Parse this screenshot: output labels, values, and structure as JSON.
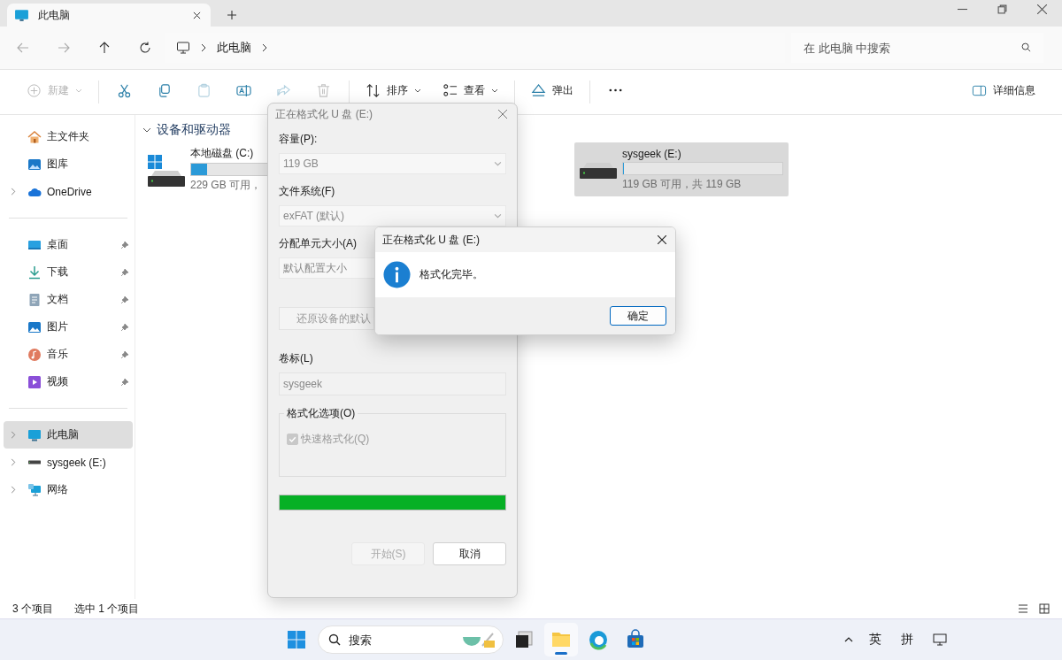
{
  "window": {
    "tab": "此电脑"
  },
  "nav": {
    "breadcrumb": [
      "此电脑"
    ],
    "search": {
      "placeholder": "在 此电脑 中搜索"
    }
  },
  "toolbar": {
    "items": [
      {
        "kind": "new",
        "label": "新建",
        "disabled": true
      },
      {
        "kind": "cut",
        "disabled": false
      },
      {
        "kind": "copy",
        "disabled": false
      },
      {
        "kind": "paste",
        "disabled": true
      },
      {
        "kind": "rename",
        "disabled": false
      },
      {
        "kind": "share",
        "disabled": true
      },
      {
        "kind": "delete",
        "disabled": true
      },
      {
        "kind": "sort",
        "label": "排序",
        "disabled": false
      },
      {
        "kind": "view",
        "label": "查看",
        "disabled": false
      },
      {
        "kind": "eject",
        "label": "弹出",
        "disabled": false
      },
      {
        "kind": "more",
        "disabled": false
      }
    ],
    "details": "详细信息"
  },
  "sidebar": {
    "groups": [
      [
        {
          "label": "主文件夹",
          "kind": "home",
          "expandable": false,
          "pinned": false,
          "selected": false
        },
        {
          "label": "图库",
          "kind": "gallery",
          "expandable": false,
          "pinned": false,
          "selected": false
        },
        {
          "label": "OneDrive",
          "kind": "cloud",
          "expandable": true,
          "pinned": false,
          "selected": false
        }
      ],
      [
        {
          "label": "桌面",
          "kind": "desktop",
          "expandable": false,
          "pinned": true,
          "selected": false
        },
        {
          "label": "下载",
          "kind": "download",
          "expandable": false,
          "pinned": true,
          "selected": false
        },
        {
          "label": "文档",
          "kind": "document",
          "expandable": false,
          "pinned": true,
          "selected": false
        },
        {
          "label": "图片",
          "kind": "pictures",
          "expandable": false,
          "pinned": true,
          "selected": false
        },
        {
          "label": "音乐",
          "kind": "music",
          "expandable": false,
          "pinned": true,
          "selected": false
        },
        {
          "label": "视频",
          "kind": "video",
          "expandable": false,
          "pinned": true,
          "selected": false
        }
      ],
      [
        {
          "label": "此电脑",
          "kind": "pc",
          "expandable": true,
          "pinned": false,
          "selected": true
        },
        {
          "label": "sysgeek (E:)",
          "kind": "usb",
          "expandable": true,
          "pinned": false,
          "selected": false
        },
        {
          "label": "网络",
          "kind": "network",
          "expandable": true,
          "pinned": false,
          "selected": false
        }
      ]
    ]
  },
  "content": {
    "section": "设备和驱动器",
    "drives": [
      {
        "kind": "system",
        "name": "本地磁盘 (C:)",
        "level": 0.1,
        "free": "229 GB 可用，",
        "selected": false
      },
      {
        "kind": "usb",
        "name": "sysgeek (E:)",
        "level": 0,
        "free": "119 GB 可用，共 119 GB",
        "selected": true
      }
    ]
  },
  "status_bar": {
    "count": "3 个项目",
    "selection": "选中 1 个项目"
  },
  "format_dialog": {
    "title": "正在格式化 U 盘 (E:)",
    "capacity": {
      "label": "容量(P):",
      "value": "119 GB"
    },
    "file_system": {
      "label": "文件系统(F)",
      "value": "exFAT (默认)"
    },
    "allocation": {
      "label": "分配单元大小(A)",
      "value": "默认配置大小"
    },
    "restore_button": "还原设备的默认",
    "volume": {
      "label": "卷标(L)",
      "value": "sysgeek"
    },
    "options": {
      "label": "格式化选项(O)",
      "quick": {
        "label": "快速格式化(Q)",
        "checked": true,
        "disabled": true
      }
    },
    "progress": {
      "level": 1
    },
    "buttons": [
      {
        "label": "开始(S)",
        "disabled": true
      },
      {
        "label": "取消",
        "disabled": false
      }
    ]
  },
  "message_box": {
    "title": "正在格式化 U 盘 (E:)",
    "message": "格式化完毕。",
    "button": "确定"
  },
  "taskbar": {
    "search": {
      "placeholder": "搜索"
    },
    "apps": [
      {
        "kind": "taskview",
        "selected": false
      },
      {
        "kind": "explorer",
        "selected": true
      },
      {
        "kind": "edge",
        "selected": false
      },
      {
        "kind": "store",
        "selected": false
      }
    ],
    "tray": [
      "英",
      "拼"
    ]
  }
}
